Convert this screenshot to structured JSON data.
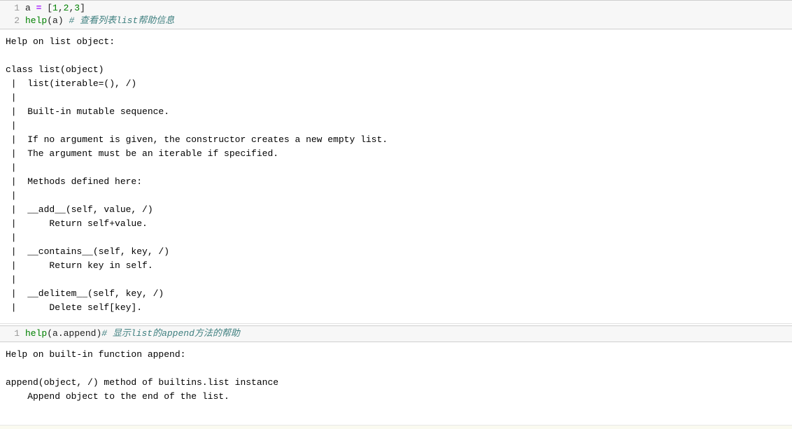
{
  "cell1": {
    "lineNumbers": [
      "1",
      "2"
    ],
    "line1": {
      "var": "a",
      "eq": " = ",
      "lb": "[",
      "n1": "1",
      "c1": ",",
      "n2": "2",
      "c2": ",",
      "n3": "3",
      "rb": "]"
    },
    "line2": {
      "func": "help",
      "lp": "(",
      "arg": "a",
      "rp": ") ",
      "comment": "# 查看列表list帮助信息"
    }
  },
  "output1": "Help on list object:\n\nclass list(object)\n |  list(iterable=(), /)\n |  \n |  Built-in mutable sequence.\n |  \n |  If no argument is given, the constructor creates a new empty list.\n |  The argument must be an iterable if specified.\n |  \n |  Methods defined here:\n |  \n |  __add__(self, value, /)\n |      Return self+value.\n |  \n |  __contains__(self, key, /)\n |      Return key in self.\n |  \n |  __delitem__(self, key, /)\n |      Delete self[key].",
  "cell2": {
    "lineNumbers": [
      "1"
    ],
    "line1": {
      "func": "help",
      "lp": "(",
      "arg": "a.append",
      "rp": ")",
      "comment": "# 显示list的append方法的帮助"
    }
  },
  "output2": "Help on built-in function append:\n\nappend(object, /) method of builtins.list instance\n    Append object to the end of the list.\n"
}
